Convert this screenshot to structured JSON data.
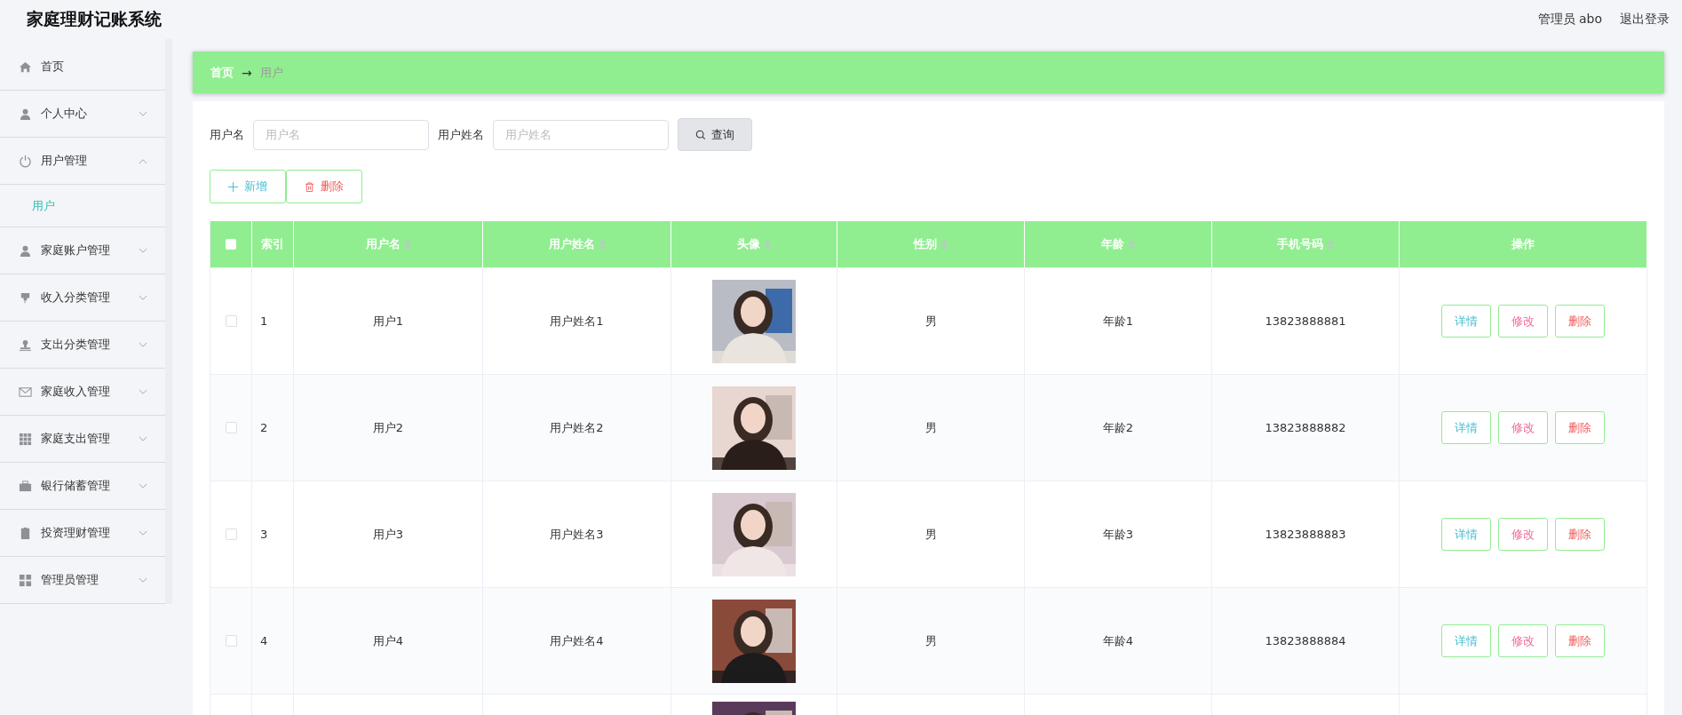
{
  "header": {
    "title": "家庭理财记账系统",
    "user": "管理员 abo",
    "logout": "退出登录"
  },
  "sidebar": {
    "items": [
      {
        "label": "首页"
      },
      {
        "label": "个人中心",
        "expanded": false
      },
      {
        "label": "用户管理",
        "expanded": true,
        "children": [
          {
            "label": "用户",
            "selected": true
          }
        ]
      },
      {
        "label": "家庭账户管理",
        "expanded": false
      },
      {
        "label": "收入分类管理",
        "expanded": false
      },
      {
        "label": "支出分类管理",
        "expanded": false
      },
      {
        "label": "家庭收入管理",
        "expanded": false
      },
      {
        "label": "家庭支出管理",
        "expanded": false
      },
      {
        "label": "银行储蓄管理",
        "expanded": false
      },
      {
        "label": "投资理财管理",
        "expanded": false
      },
      {
        "label": "管理员管理",
        "expanded": false
      }
    ]
  },
  "breadcrumb": {
    "home": "首页",
    "arrow": "→",
    "current": "用户"
  },
  "search": {
    "fields": [
      {
        "label": "用户名",
        "placeholder": "用户名"
      },
      {
        "label": "用户姓名",
        "placeholder": "用户姓名"
      }
    ],
    "button": "查询"
  },
  "actions": {
    "add": "新增",
    "delete": "删除"
  },
  "table": {
    "select_all": {
      "checked": false
    },
    "columns": [
      {
        "label": "索引",
        "sortable": false
      },
      {
        "label": "用户名",
        "sortable": true
      },
      {
        "label": "用户姓名",
        "sortable": true
      },
      {
        "label": "头像",
        "sortable": true
      },
      {
        "label": "性别",
        "sortable": true
      },
      {
        "label": "年龄",
        "sortable": true
      },
      {
        "label": "手机号码",
        "sortable": true
      },
      {
        "label": "操作",
        "sortable": false
      }
    ],
    "rows": [
      {
        "index": "1",
        "username": "用户1",
        "name": "用户姓名1",
        "avatar": {
          "kind": "picture"
        },
        "gender": "男",
        "age": "年龄1",
        "phone": "13823888881",
        "buttons": [
          "详情",
          "修改",
          "删除"
        ],
        "checked": false
      },
      {
        "index": "2",
        "username": "用户2",
        "name": "用户姓名2",
        "avatar": {
          "kind": "picture"
        },
        "gender": "男",
        "age": "年龄2",
        "phone": "13823888882",
        "buttons": [
          "详情",
          "修改",
          "删除"
        ],
        "checked": false
      },
      {
        "index": "3",
        "username": "用户3",
        "name": "用户姓名3",
        "avatar": {
          "kind": "picture"
        },
        "gender": "男",
        "age": "年龄3",
        "phone": "13823888883",
        "buttons": [
          "详情",
          "修改",
          "删除"
        ],
        "checked": false
      },
      {
        "index": "4",
        "username": "用户4",
        "name": "用户姓名4",
        "avatar": {
          "kind": "picture"
        },
        "gender": "男",
        "age": "年龄4",
        "phone": "13823888884",
        "buttons": [
          "详情",
          "修改",
          "删除"
        ],
        "checked": false
      },
      {
        "avatar": {
          "kind": "picture"
        }
      }
    ]
  }
}
